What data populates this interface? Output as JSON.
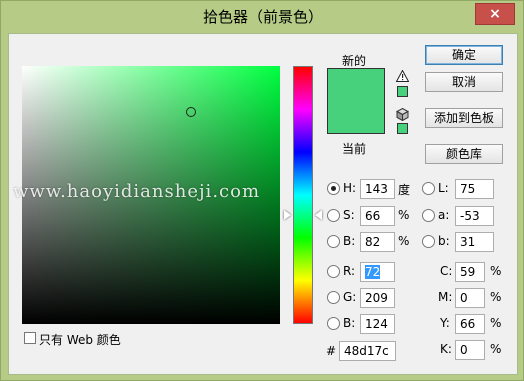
{
  "window": {
    "title": "拾色器（前景色）",
    "close_label": "×"
  },
  "swatch": {
    "new_label": "新的",
    "current_label": "当前",
    "new_color": "#48d17c",
    "current_color": "#48d17c"
  },
  "buttons": {
    "ok": "确定",
    "cancel": "取消",
    "add_to_swatches": "添加到色板",
    "color_libraries": "颜色库"
  },
  "hsb": {
    "h_label": "H:",
    "h_value": "143",
    "h_unit": "度",
    "s_label": "S:",
    "s_value": "66",
    "s_unit": "%",
    "b_label": "B:",
    "b_value": "82",
    "b_unit": "%"
  },
  "lab": {
    "l_label": "L:",
    "l_value": "75",
    "a_label": "a:",
    "a_value": "-53",
    "b_label": "b:",
    "b_value": "31"
  },
  "rgb": {
    "r_label": "R:",
    "r_value": "72",
    "g_label": "G:",
    "g_value": "209",
    "b_label": "B:",
    "b_value": "124"
  },
  "cmyk": {
    "c_label": "C:",
    "c_value": "59",
    "m_label": "M:",
    "m_value": "0",
    "y_label": "Y:",
    "y_value": "66",
    "k_label": "K:",
    "k_value": "0",
    "unit": "%"
  },
  "hex": {
    "label": "#",
    "value": "48d17c"
  },
  "web_only": {
    "label": "只有 Web 颜色"
  },
  "watermark": "www.haoyidiansheji.com",
  "icons": {
    "gamut_warning": "warning-icon",
    "web_safe": "cube-icon"
  }
}
